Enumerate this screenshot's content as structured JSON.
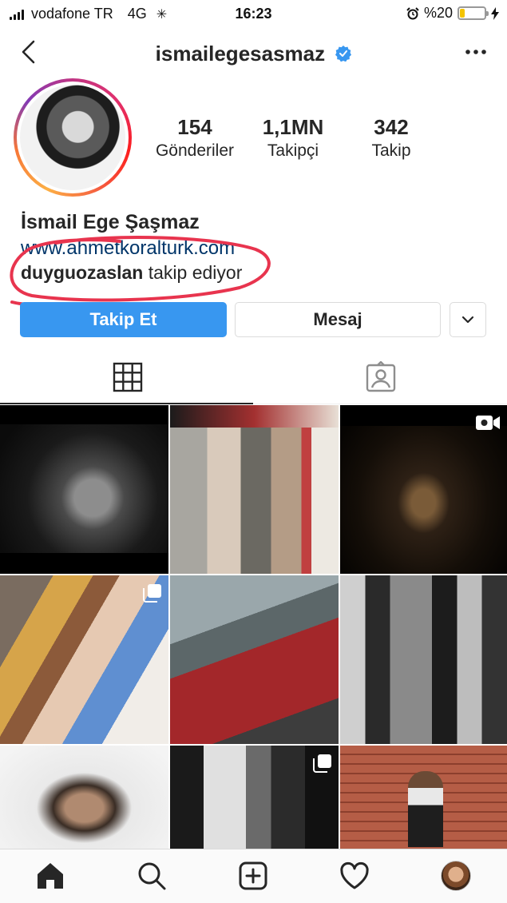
{
  "status_bar": {
    "carrier": "vodafone TR",
    "network": "4G",
    "time": "16:23",
    "battery": "%20",
    "battery_level": 0.2,
    "battery_color": "#f4c400"
  },
  "header": {
    "username": "ismailegesasmaz",
    "verified": true,
    "back_icon": "chevron-left-icon",
    "more_icon": "more-dots-icon"
  },
  "profile": {
    "stats": [
      {
        "value": "154",
        "label": "Gönderiler"
      },
      {
        "value": "1,1MN",
        "label": "Takipçi"
      },
      {
        "value": "342",
        "label": "Takip"
      }
    ],
    "full_name": "İsmail Ege Şaşmaz",
    "website": "www.ahmetkoralturk.com",
    "followed_by_user": "duyguozaslan",
    "followed_by_text": "takip ediyor"
  },
  "actions": {
    "follow_label": "Takip Et",
    "message_label": "Mesaj",
    "more_icon": "chevron-down-icon",
    "follow_color": "#3897f0"
  },
  "tabs": {
    "items": [
      "grid-icon",
      "tagged-icon"
    ],
    "active": 0
  },
  "grid": {
    "posts": [
      {
        "badge": null
      },
      {
        "badge": null
      },
      {
        "badge": "igtv-icon"
      },
      {
        "badge": "multiple-icon"
      },
      {
        "badge": null
      },
      {
        "badge": null
      },
      {
        "badge": null
      },
      {
        "badge": "multiple-icon"
      },
      {
        "badge": null
      }
    ]
  },
  "bottom_nav": {
    "items": [
      "home-icon",
      "search-icon",
      "add-icon",
      "heart-icon",
      "profile-icon"
    ]
  },
  "annotation_color": "#e8344e"
}
